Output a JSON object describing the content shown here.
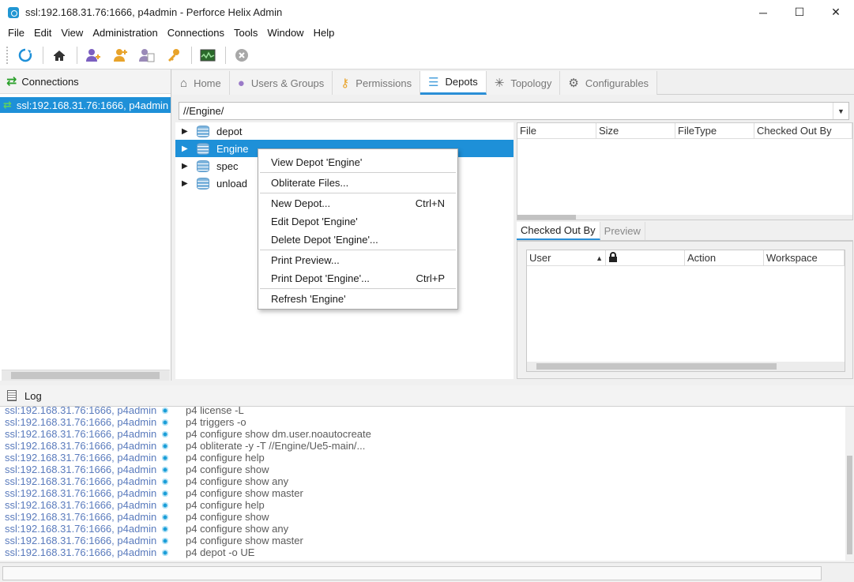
{
  "window": {
    "title": "ssl:192.168.31.76:1666,  p4admin - Perforce Helix Admin",
    "minimize": "─",
    "maximize": "☐",
    "close": "✕"
  },
  "menu": [
    "File",
    "Edit",
    "View",
    "Administration",
    "Connections",
    "Tools",
    "Window",
    "Help"
  ],
  "toolbar": {
    "icons": [
      "refresh-icon",
      "home-icon",
      "add-user-icon",
      "add-group-icon",
      "user-permissions-icon",
      "key-icon",
      "monitor-icon",
      "stop-icon"
    ]
  },
  "connections": {
    "header": "Connections",
    "items": [
      "ssl:192.168.31.76:1666,  p4admin"
    ]
  },
  "tabs": [
    {
      "label": "Home",
      "icon": "home-icon"
    },
    {
      "label": "Users & Groups",
      "icon": "users-icon"
    },
    {
      "label": "Permissions",
      "icon": "key-icon"
    },
    {
      "label": "Depots",
      "icon": "depot-icon",
      "active": true
    },
    {
      "label": "Topology",
      "icon": "topology-icon"
    },
    {
      "label": "Configurables",
      "icon": "gear-icon"
    }
  ],
  "path": "//Engine/",
  "tree": [
    {
      "label": "depot"
    },
    {
      "label": "Engine",
      "selected": true
    },
    {
      "label": "spec"
    },
    {
      "label": "unload"
    }
  ],
  "file_columns": [
    "File",
    "Size",
    "FileType",
    "Checked Out By"
  ],
  "sub_tabs": [
    "Checked Out By",
    "Preview"
  ],
  "checkout_columns": [
    "User",
    "",
    "Action",
    "Workspace"
  ],
  "context_menu": [
    {
      "label": "View Depot 'Engine'",
      "shortcut": ""
    },
    {
      "sep": true
    },
    {
      "label": "Obliterate Files...",
      "shortcut": ""
    },
    {
      "sep": true
    },
    {
      "label": "New Depot...",
      "shortcut": "Ctrl+N"
    },
    {
      "label": "Edit Depot 'Engine'",
      "shortcut": ""
    },
    {
      "label": "Delete Depot 'Engine'...",
      "shortcut": ""
    },
    {
      "sep": true
    },
    {
      "label": "Print Preview...",
      "shortcut": ""
    },
    {
      "label": "Print Depot 'Engine'...",
      "shortcut": "Ctrl+P"
    },
    {
      "sep": true
    },
    {
      "label": "Refresh 'Engine'",
      "shortcut": ""
    }
  ],
  "log": {
    "header": "Log",
    "entries": [
      {
        "conn": "ssl:192.168.31.76:1666,  p4admin",
        "cmd": "p4 license -L"
      },
      {
        "conn": "ssl:192.168.31.76:1666,  p4admin",
        "cmd": "p4 triggers -o"
      },
      {
        "conn": "ssl:192.168.31.76:1666,  p4admin",
        "cmd": "p4 configure show dm.user.noautocreate"
      },
      {
        "conn": "ssl:192.168.31.76:1666,  p4admin",
        "cmd": "p4 obliterate -y -T //Engine/Ue5-main/..."
      },
      {
        "conn": "ssl:192.168.31.76:1666,  p4admin",
        "cmd": "p4 configure help"
      },
      {
        "conn": "ssl:192.168.31.76:1666,  p4admin",
        "cmd": "p4 configure show"
      },
      {
        "conn": "ssl:192.168.31.76:1666,  p4admin",
        "cmd": "p4 configure show any"
      },
      {
        "conn": "ssl:192.168.31.76:1666,  p4admin",
        "cmd": "p4 configure show master"
      },
      {
        "conn": "ssl:192.168.31.76:1666,  p4admin",
        "cmd": "p4 configure help"
      },
      {
        "conn": "ssl:192.168.31.76:1666,  p4admin",
        "cmd": "p4 configure show"
      },
      {
        "conn": "ssl:192.168.31.76:1666,  p4admin",
        "cmd": "p4 configure show any"
      },
      {
        "conn": "ssl:192.168.31.76:1666,  p4admin",
        "cmd": "p4 configure show master"
      },
      {
        "conn": "ssl:192.168.31.76:1666,  p4admin",
        "cmd": "p4 depot -o UE"
      }
    ]
  },
  "colors": {
    "accent": "#1e90d8",
    "log_conn": "#5a7bbd",
    "connections_icon": "#2aa02a"
  }
}
